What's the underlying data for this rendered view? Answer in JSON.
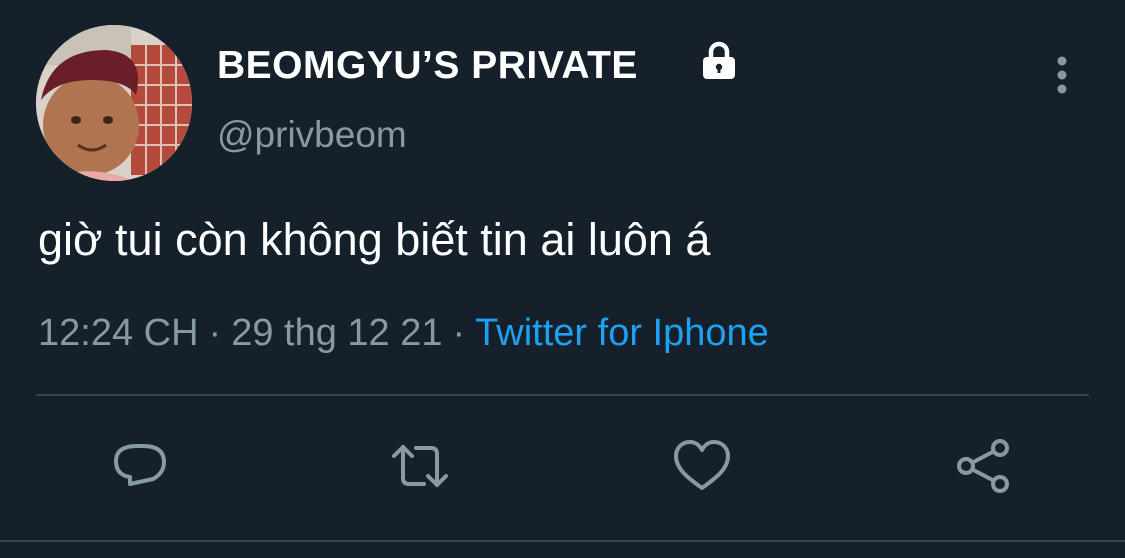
{
  "user": {
    "display_name": "BEOMGYU’S PRIVATE",
    "handle": "@privbeom",
    "protected_icon": "lock-icon"
  },
  "tweet": {
    "text": "giờ tui còn không biết tin ai luôn á",
    "time": "12:24 CH",
    "date": "29 thg 12 21",
    "separator": "·",
    "source": "Twitter for Iphone"
  },
  "actions": {
    "reply_icon": "reply-icon",
    "retweet_icon": "retweet-icon",
    "like_icon": "heart-icon",
    "share_icon": "share-icon"
  },
  "colors": {
    "background": "#15202b",
    "primary_text": "#ffffff",
    "secondary_text": "#8899a6",
    "link": "#1da1f2",
    "divider": "#38444d"
  }
}
